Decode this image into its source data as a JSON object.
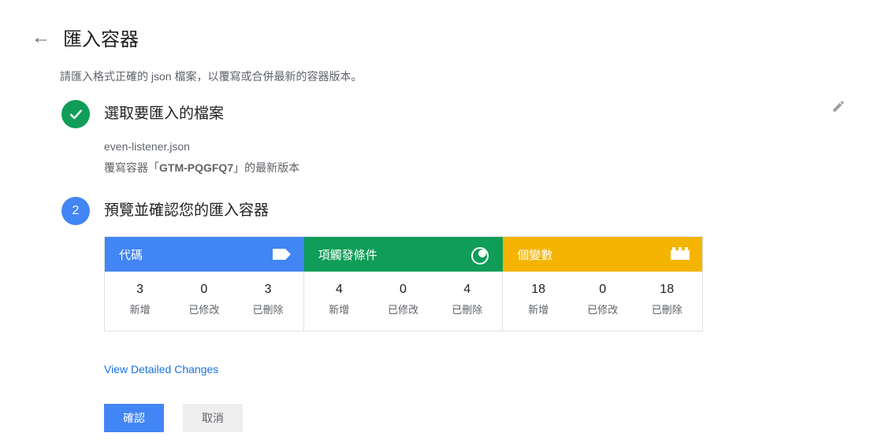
{
  "header": {
    "title": "匯入容器"
  },
  "subtitle": "請匯入格式正確的 json 檔案，以覆寫或合併最新的容器版本。",
  "step1": {
    "title": "選取要匯入的檔案",
    "filename": "even-listener.json",
    "desc_prefix": "覆寫容器「",
    "container_id": "GTM-PQGFQ7",
    "desc_suffix": "」的最新版本"
  },
  "step2": {
    "number": "2",
    "title": "預覽並確認您的匯入容器"
  },
  "summary": {
    "labels": {
      "added": "新增",
      "modified": "已修改",
      "deleted": "已刪除"
    },
    "tags": {
      "title": "代碼",
      "added": "3",
      "modified": "0",
      "deleted": "3"
    },
    "triggers": {
      "title": "項觸發條件",
      "added": "4",
      "modified": "0",
      "deleted": "4"
    },
    "vars": {
      "title": "個變數",
      "added": "18",
      "modified": "0",
      "deleted": "18"
    }
  },
  "links": {
    "details": "View Detailed Changes"
  },
  "actions": {
    "confirm": "確認",
    "cancel": "取消"
  }
}
